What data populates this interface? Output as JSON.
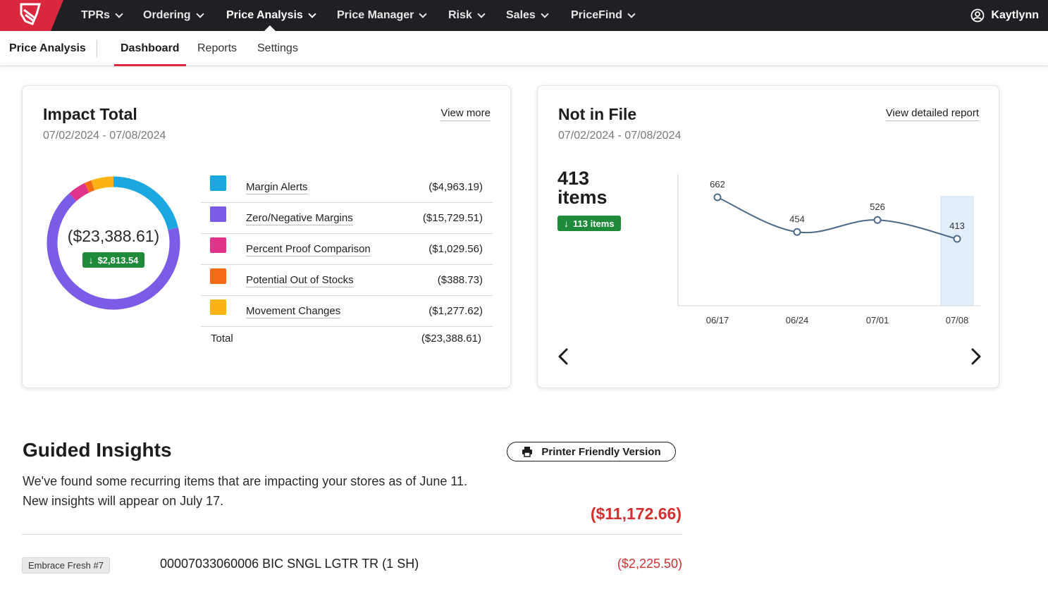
{
  "nav": {
    "items": [
      {
        "label": "TPRs"
      },
      {
        "label": "Ordering"
      },
      {
        "label": "Price Analysis"
      },
      {
        "label": "Price Manager"
      },
      {
        "label": "Risk"
      },
      {
        "label": "Sales"
      },
      {
        "label": "PriceFind"
      }
    ],
    "active": "Price Analysis",
    "user": "Kaytlynn"
  },
  "subnav": {
    "title": "Price Analysis",
    "tabs": [
      {
        "label": "Dashboard"
      },
      {
        "label": "Reports"
      },
      {
        "label": "Settings"
      }
    ],
    "active": "Dashboard"
  },
  "impact": {
    "title": "Impact Total",
    "date_range": "07/02/2024 - 07/08/2024",
    "view_more": "View more",
    "total": "($23,388.61)",
    "change": "$2,813.54",
    "rows": [
      {
        "label": "Margin Alerts",
        "value": "($4,963.19)",
        "color": "#1ba8e0"
      },
      {
        "label": "Zero/Negative Margins",
        "value": "($15,729.51)",
        "color": "#7b5ce6"
      },
      {
        "label": "Percent Proof Comparison",
        "value": "($1,029.56)",
        "color": "#e0338a"
      },
      {
        "label": "Potential Out of Stocks",
        "value": "($388.73)",
        "color": "#f56a14"
      },
      {
        "label": "Movement Changes",
        "value": "($1,277.62)",
        "color": "#fbb214"
      }
    ],
    "total_label": "Total",
    "total_value": "($23,388.61)",
    "chart_data": {
      "type": "pie",
      "categories": [
        "Margin Alerts",
        "Zero/Negative Margins",
        "Percent Proof Comparison",
        "Potential Out of Stocks",
        "Movement Changes"
      ],
      "values": [
        4963.19,
        15729.51,
        1029.56,
        388.73,
        1277.62
      ]
    }
  },
  "not_in_file": {
    "title": "Not in File",
    "date_range": "07/02/2024 - 07/08/2024",
    "link": "View detailed report",
    "count": "413",
    "count_unit": "items",
    "change": "113 items",
    "chart_data": {
      "type": "line",
      "x": [
        "06/17",
        "06/24",
        "07/01",
        "07/08"
      ],
      "series": [
        {
          "values": [
            662,
            454,
            526,
            413
          ]
        }
      ],
      "highlight": "07/08"
    }
  },
  "insights": {
    "title": "Guided Insights",
    "print_label": "Printer Friendly Version",
    "description": "We've found some recurring items that are impacting your stores as of June 11. New insights will appear on July 17.",
    "total": "($11,172.66)",
    "items": [
      {
        "store": "Embrace Fresh #7",
        "item": "00007033060006 BIC SNGL LGTR TR (1 SH)",
        "amount": "($2,225.50)"
      }
    ]
  }
}
